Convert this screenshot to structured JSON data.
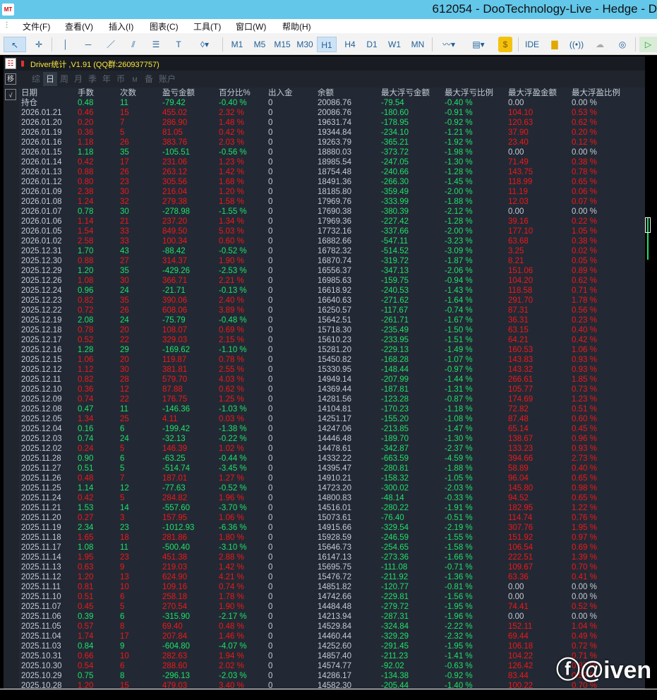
{
  "window": {
    "title": "612054 - DooTechnology-Live - Hedge - D",
    "app_icon": "mt-logo-icon"
  },
  "menu": [
    "文件(F)",
    "查看(V)",
    "插入(I)",
    "图表(C)",
    "工具(T)",
    "窗口(W)",
    "帮助(H)"
  ],
  "toolbar": {
    "timeframes": [
      "M1",
      "M5",
      "M15",
      "M30",
      "H1",
      "H4",
      "D1",
      "W1",
      "MN"
    ],
    "active": "H1",
    "ide": "IDE"
  },
  "panel": {
    "title": "Driver统计 ,V1.91 (QQ群:260937757)",
    "side": [
      "移",
      "√"
    ],
    "tabs": [
      "综",
      "日",
      "周",
      "月",
      "季",
      "年",
      "币",
      "M",
      "备",
      "账户"
    ],
    "active_tab": "日"
  },
  "table": {
    "headers": [
      "日期",
      "手数",
      "次数",
      "盈亏金额",
      "百分比%",
      "出入金",
      "余额",
      "最大浮亏金额",
      "最大浮亏比例",
      "最大浮盈金额",
      "最大浮盈比例"
    ],
    "rows": [
      [
        "持仓",
        "0.48",
        "11",
        "-79.42",
        "-0.40 %",
        "0",
        "20086.76",
        "-79.54",
        "-0.40 %",
        "0.00",
        "0.00 %"
      ],
      [
        "2026.01.21",
        "0.46",
        "15",
        "455.02",
        "2.32 %",
        "0",
        "20086.76",
        "-180.60",
        "-0.91 %",
        "104.10",
        "0.53 %"
      ],
      [
        "2026.01.20",
        "0.20",
        "7",
        "286.90",
        "1.48 %",
        "0",
        "19631.74",
        "-178.95",
        "-0.92 %",
        "120.63",
        "0.62 %"
      ],
      [
        "2026.01.19",
        "0.36",
        "5",
        "81.05",
        "0.42 %",
        "0",
        "19344.84",
        "-234.10",
        "-1.21 %",
        "37.90",
        "0.20 %"
      ],
      [
        "2026.01.16",
        "1.18",
        "26",
        "383.76",
        "2.03 %",
        "0",
        "19263.79",
        "-365.21",
        "-1.92 %",
        "23.40",
        "0.12 %"
      ],
      [
        "2026.01.15",
        "1.18",
        "35",
        "-105.51",
        "-0.56 %",
        "0",
        "18880.03",
        "-373.72",
        "-1.98 %",
        "0.00",
        "0.00 %"
      ],
      [
        "2026.01.14",
        "0.42",
        "17",
        "231.06",
        "1.23 %",
        "0",
        "18985.54",
        "-247.05",
        "-1.30 %",
        "71.49",
        "0.38 %"
      ],
      [
        "2026.01.13",
        "0.88",
        "26",
        "263.12",
        "1.42 %",
        "0",
        "18754.48",
        "-240.66",
        "-1.28 %",
        "143.75",
        "0.78 %"
      ],
      [
        "2026.01.12",
        "0.80",
        "23",
        "305.56",
        "1.68 %",
        "0",
        "18491.36",
        "-266.30",
        "-1.45 %",
        "118.99",
        "0.65 %"
      ],
      [
        "2026.01.09",
        "2.38",
        "30",
        "216.04",
        "1.20 %",
        "0",
        "18185.80",
        "-359.49",
        "-2.00 %",
        "11.19",
        "0.06 %"
      ],
      [
        "2026.01.08",
        "1.24",
        "32",
        "279.38",
        "1.58 %",
        "0",
        "17969.76",
        "-333.99",
        "-1.88 %",
        "12.03",
        "0.07 %"
      ],
      [
        "2026.01.07",
        "0.78",
        "30",
        "-278.98",
        "-1.55 %",
        "0",
        "17690.38",
        "-380.39",
        "-2.12 %",
        "0.00",
        "0.00 %"
      ],
      [
        "2026.01.06",
        "1.14",
        "21",
        "237.20",
        "1.34 %",
        "0",
        "17969.36",
        "-227.42",
        "-1.28 %",
        "39.16",
        "0.22 %"
      ],
      [
        "2026.01.05",
        "1.54",
        "33",
        "849.50",
        "5.03 %",
        "0",
        "17732.16",
        "-337.66",
        "-2.00 %",
        "177.10",
        "1.05 %"
      ],
      [
        "2026.01.02",
        "2.58",
        "33",
        "100.34",
        "0.60 %",
        "0",
        "16882.66",
        "-547.11",
        "-3.23 %",
        "63.68",
        "0.38 %"
      ],
      [
        "2025.12.31",
        "1.70",
        "43",
        "-88.42",
        "-0.52 %",
        "0",
        "16782.32",
        "-514.52",
        "-3.09 %",
        "3.25",
        "0.02 %"
      ],
      [
        "2025.12.30",
        "0.88",
        "27",
        "314.37",
        "1.90 %",
        "0",
        "16870.74",
        "-319.72",
        "-1.87 %",
        "8.21",
        "0.05 %"
      ],
      [
        "2025.12.29",
        "1.20",
        "35",
        "-429.26",
        "-2.53 %",
        "0",
        "16556.37",
        "-347.13",
        "-2.06 %",
        "151.06",
        "0.89 %"
      ],
      [
        "2025.12.26",
        "1.08",
        "30",
        "366.71",
        "2.21 %",
        "0",
        "16985.63",
        "-159.75",
        "-0.94 %",
        "104.20",
        "0.62 %"
      ],
      [
        "2025.12.24",
        "0.96",
        "24",
        "-21.71",
        "-0.13 %",
        "0",
        "16618.92",
        "-240.53",
        "-1.43 %",
        "118.58",
        "0.71 %"
      ],
      [
        "2025.12.23",
        "0.82",
        "35",
        "390.06",
        "2.40 %",
        "0",
        "16640.63",
        "-271.62",
        "-1.64 %",
        "291.70",
        "1.78 %"
      ],
      [
        "2025.12.22",
        "0.72",
        "26",
        "608.06",
        "3.89 %",
        "0",
        "16250.57",
        "-117.67",
        "-0.74 %",
        "87.31",
        "0.56 %"
      ],
      [
        "2025.12.19",
        "2.08",
        "24",
        "-75.79",
        "-0.48 %",
        "0",
        "15642.51",
        "-261.71",
        "-1.67 %",
        "36.31",
        "0.23 %"
      ],
      [
        "2025.12.18",
        "0.78",
        "20",
        "108.07",
        "0.69 %",
        "0",
        "15718.30",
        "-235.49",
        "-1.50 %",
        "63.15",
        "0.40 %"
      ],
      [
        "2025.12.17",
        "0.52",
        "22",
        "329.03",
        "2.15 %",
        "0",
        "15610.23",
        "-233.95",
        "-1.51 %",
        "64.21",
        "0.42 %"
      ],
      [
        "2025.12.16",
        "1.28",
        "29",
        "-169.62",
        "-1.10 %",
        "0",
        "15281.20",
        "-229.13",
        "-1.49 %",
        "160.53",
        "1.06 %"
      ],
      [
        "2025.12.15",
        "1.06",
        "20",
        "119.87",
        "0.78 %",
        "0",
        "15450.82",
        "-168.28",
        "-1.07 %",
        "143.83",
        "0.93 %"
      ],
      [
        "2025.12.12",
        "1.12",
        "30",
        "381.81",
        "2.55 %",
        "0",
        "15330.95",
        "-148.44",
        "-0.97 %",
        "143.32",
        "0.93 %"
      ],
      [
        "2025.12.11",
        "0.82",
        "28",
        "579.70",
        "4.03 %",
        "0",
        "14949.14",
        "-207.99",
        "-1.44 %",
        "266.61",
        "1.85 %"
      ],
      [
        "2025.12.10",
        "0.36",
        "12",
        "87.88",
        "0.62 %",
        "0",
        "14369.44",
        "-187.81",
        "-1.31 %",
        "105.77",
        "0.73 %"
      ],
      [
        "2025.12.09",
        "0.74",
        "22",
        "176.75",
        "1.25 %",
        "0",
        "14281.56",
        "-123.28",
        "-0.87 %",
        "174.69",
        "1.23 %"
      ],
      [
        "2025.12.08",
        "0.47",
        "11",
        "-146.36",
        "-1.03 %",
        "0",
        "14104.81",
        "-170.23",
        "-1.18 %",
        "72.82",
        "0.51 %"
      ],
      [
        "2025.12.05",
        "1.34",
        "25",
        "4.11",
        "0.03 %",
        "0",
        "14251.17",
        "-155.20",
        "-1.08 %",
        "87.48",
        "0.60 %"
      ],
      [
        "2025.12.04",
        "0.16",
        "6",
        "-199.42",
        "-1.38 %",
        "0",
        "14247.06",
        "-213.85",
        "-1.47 %",
        "65.14",
        "0.45 %"
      ],
      [
        "2025.12.03",
        "0.74",
        "24",
        "-32.13",
        "-0.22 %",
        "0",
        "14446.48",
        "-189.70",
        "-1.30 %",
        "138.67",
        "0.96 %"
      ],
      [
        "2025.12.02",
        "0.24",
        "5",
        "146.39",
        "1.02 %",
        "0",
        "14478.61",
        "-342.87",
        "-2.37 %",
        "133.23",
        "0.93 %"
      ],
      [
        "2025.11.28",
        "0.90",
        "6",
        "-63.25",
        "-0.44 %",
        "0",
        "14332.22",
        "-663.59",
        "-4.59 %",
        "394.66",
        "2.73 %"
      ],
      [
        "2025.11.27",
        "0.51",
        "5",
        "-514.74",
        "-3.45 %",
        "0",
        "14395.47",
        "-280.81",
        "-1.88 %",
        "58.89",
        "0.40 %"
      ],
      [
        "2025.11.26",
        "0.48",
        "7",
        "187.01",
        "1.27 %",
        "0",
        "14910.21",
        "-158.32",
        "-1.05 %",
        "96.04",
        "0.65 %"
      ],
      [
        "2025.11.25",
        "1.14",
        "12",
        "-77.63",
        "-0.52 %",
        "0",
        "14723.20",
        "-300.02",
        "-2.03 %",
        "145.80",
        "0.98 %"
      ],
      [
        "2025.11.24",
        "0.42",
        "5",
        "284.82",
        "1.96 %",
        "0",
        "14800.83",
        "-48.14",
        "-0.33 %",
        "94.52",
        "0.65 %"
      ],
      [
        "2025.11.21",
        "1.53",
        "14",
        "-557.60",
        "-3.70 %",
        "0",
        "14516.01",
        "-280.22",
        "-1.91 %",
        "182.95",
        "1.22 %"
      ],
      [
        "2025.11.20",
        "0.27",
        "3",
        "157.95",
        "1.06 %",
        "0",
        "15073.61",
        "-76.40",
        "-0.51 %",
        "114.74",
        "0.76 %"
      ],
      [
        "2025.11.19",
        "2.34",
        "23",
        "-1012.93",
        "-6.36 %",
        "0",
        "14915.66",
        "-329.54",
        "-2.19 %",
        "307.76",
        "1.95 %"
      ],
      [
        "2025.11.18",
        "1.65",
        "18",
        "281.86",
        "1.80 %",
        "0",
        "15928.59",
        "-246.59",
        "-1.55 %",
        "151.92",
        "0.97 %"
      ],
      [
        "2025.11.17",
        "1.08",
        "11",
        "-500.40",
        "-3.10 %",
        "0",
        "15646.73",
        "-254.65",
        "-1.58 %",
        "106.54",
        "0.69 %"
      ],
      [
        "2025.11.14",
        "1.95",
        "23",
        "451.38",
        "2.88 %",
        "0",
        "16147.13",
        "-273.36",
        "-1.66 %",
        "222.51",
        "1.39 %"
      ],
      [
        "2025.11.13",
        "0.63",
        "9",
        "219.03",
        "1.42 %",
        "0",
        "15695.75",
        "-111.08",
        "-0.71 %",
        "109.67",
        "0.70 %"
      ],
      [
        "2025.11.12",
        "1.20",
        "13",
        "624.90",
        "4.21 %",
        "0",
        "15476.72",
        "-211.92",
        "-1.36 %",
        "63.36",
        "0.41 %"
      ],
      [
        "2025.11.11",
        "0.81",
        "10",
        "109.16",
        "0.74 %",
        "0",
        "14851.82",
        "-120.77",
        "-0.81 %",
        "0.00",
        "0.00 %"
      ],
      [
        "2025.11.10",
        "0.51",
        "6",
        "258.18",
        "1.78 %",
        "0",
        "14742.66",
        "-229.81",
        "-1.56 %",
        "0.00",
        "0.00 %"
      ],
      [
        "2025.11.07",
        "0.45",
        "5",
        "270.54",
        "1.90 %",
        "0",
        "14484.48",
        "-279.72",
        "-1.95 %",
        "74.41",
        "0.52 %"
      ],
      [
        "2025.11.06",
        "0.39",
        "6",
        "-315.90",
        "-2.17 %",
        "0",
        "14213.94",
        "-287.31",
        "-1.96 %",
        "0.00",
        "0.00 %"
      ],
      [
        "2025.11.05",
        "0.57",
        "8",
        "69.40",
        "0.48 %",
        "0",
        "14529.84",
        "-324.84",
        "-2.22 %",
        "152.11",
        "1.04 %"
      ],
      [
        "2025.11.04",
        "1.74",
        "17",
        "207.84",
        "1.46 %",
        "0",
        "14460.44",
        "-329.29",
        "-2.32 %",
        "69.44",
        "0.49 %"
      ],
      [
        "2025.11.03",
        "0.84",
        "9",
        "-604.80",
        "-4.07 %",
        "0",
        "14252.60",
        "-291.45",
        "-1.95 %",
        "106.18",
        "0.72 %"
      ],
      [
        "2025.10.31",
        "0.66",
        "10",
        "282.63",
        "1.94 %",
        "0",
        "14857.40",
        "-211.23",
        "-1.41 %",
        "104.22",
        "0.71 %"
      ],
      [
        "2025.10.30",
        "0.54",
        "6",
        "288.60",
        "2.02 %",
        "0",
        "14574.77",
        "-92.02",
        "-0.63 %",
        "126.42",
        "0.87 %"
      ],
      [
        "2025.10.29",
        "0.75",
        "8",
        "-296.13",
        "-2.03 %",
        "0",
        "14286.17",
        "-134.38",
        "-0.92 %",
        "83.44",
        "0.57 %"
      ],
      [
        "2025.10.28",
        "1.20",
        "15",
        "479.03",
        "3.40 %",
        "0",
        "14582.30",
        "-205.44",
        "-1.40 %",
        "100.22",
        "0.70 %"
      ]
    ]
  },
  "watermark": "@iven",
  "colors": {
    "profit": "#f01818",
    "loss": "#1ee26a",
    "neutral": "#c6ccd4",
    "panel_bg": "#232934",
    "title_bg": "#63c7ea"
  }
}
